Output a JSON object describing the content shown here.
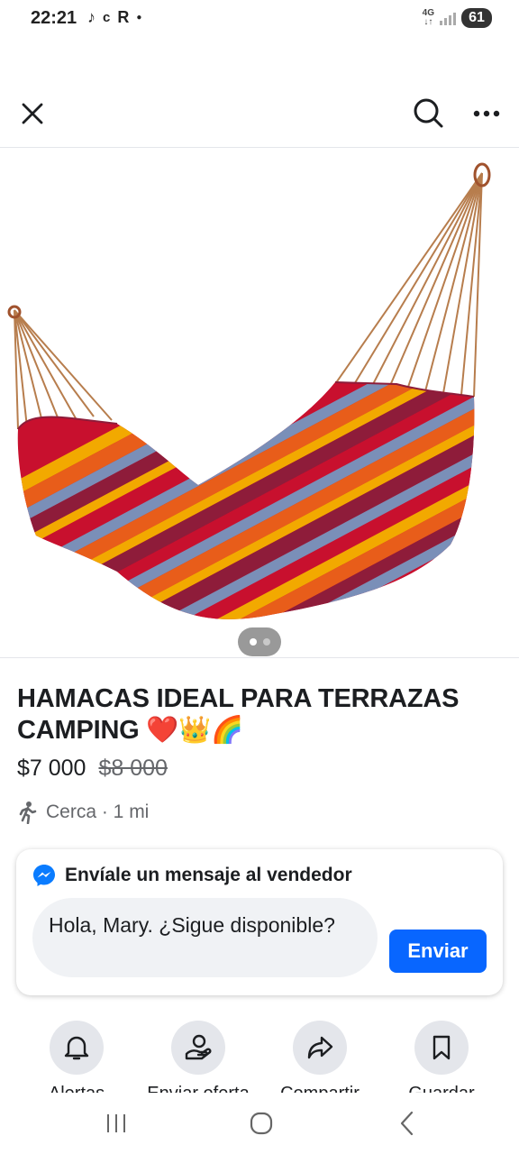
{
  "status_bar": {
    "time": "22:21",
    "left_icons": [
      "tiktok-icon",
      "c-icon",
      "r-icon",
      "dot-icon"
    ],
    "network": "4G",
    "battery": "61"
  },
  "top_bar": {
    "icons": [
      "close-icon",
      "search-icon",
      "more-icon"
    ]
  },
  "listing": {
    "title": "HAMACAS IDEAL PARA TERRAZAS CAMPING ❤️👑🌈",
    "price": "$7 000",
    "original_price": "$8 000",
    "location": "Cerca · 1 mi",
    "photo_count": 2,
    "active_photo": 1
  },
  "message_card": {
    "heading": "Envíale un mensaje al vendedor",
    "input_value": "Hola, Mary. ¿Sigue disponible?",
    "send_label": "Enviar"
  },
  "actions": [
    {
      "icon": "bell-icon",
      "label": "Alertas"
    },
    {
      "icon": "offer-icon",
      "label": "Enviar oferta"
    },
    {
      "icon": "share-icon",
      "label": "Compartir"
    },
    {
      "icon": "bookmark-icon",
      "label": "Guardar"
    }
  ],
  "colors": {
    "accent": "#0866ff",
    "messenger": "#0a7cff",
    "secondary_text": "#65676b",
    "hammock": [
      "#c8102e",
      "#f2a900",
      "#e85d1a",
      "#7a8fb8",
      "#8e1c3a"
    ]
  }
}
